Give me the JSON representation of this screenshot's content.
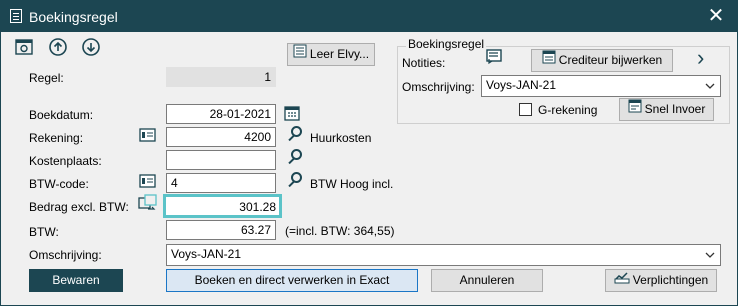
{
  "window": {
    "title": "Boekingsregel",
    "close_glyph": "✕"
  },
  "toolbar": {
    "icons": [
      "settings-icon",
      "up-arrow-icon",
      "down-arrow-icon"
    ]
  },
  "leer_button": "Leer Elvy...",
  "boekingsregel_group": {
    "title": "Boekingsregel",
    "notities_label": "Notities:",
    "crediteur_button": "Crediteur bijwerken",
    "next_glyph": "›",
    "omschrijving_label": "Omschrijving:",
    "omschrijving_value": "Voys-JAN-21",
    "g_rekening_label": "G-rekening",
    "snel_invoer_button": "Snel Invoer"
  },
  "form": {
    "regel_label": "Regel:",
    "regel_value": "1",
    "boekdatum_label": "Boekdatum:",
    "boekdatum_value": "28-01-2021",
    "rekening_label": "Rekening:",
    "rekening_value": "4200",
    "rekening_desc": "Huurkosten",
    "kostenplaats_label": "Kostenplaats:",
    "kostenplaats_value": "",
    "btw_code_label": "BTW-code:",
    "btw_code_value": "4",
    "btw_code_desc": "BTW Hoog incl.",
    "bedrag_label": "Bedrag excl. BTW:",
    "bedrag_value": "301.28",
    "btw_label": "BTW:",
    "btw_value": "63.27",
    "btw_incl_note": "(=incl. BTW: 364,55)",
    "omschrijving_label": "Omschrijving:",
    "omschrijving_value": "Voys-JAN-21"
  },
  "buttons": {
    "bewaren": "Bewaren",
    "boeken": "Boeken en direct verwerken in Exact",
    "annuleren": "Annuleren",
    "verplichtingen": "Verplichtingen"
  },
  "colors": {
    "titlebar": "#1c4652",
    "focus": "#5bc3c8",
    "primary": "#1c4652"
  }
}
